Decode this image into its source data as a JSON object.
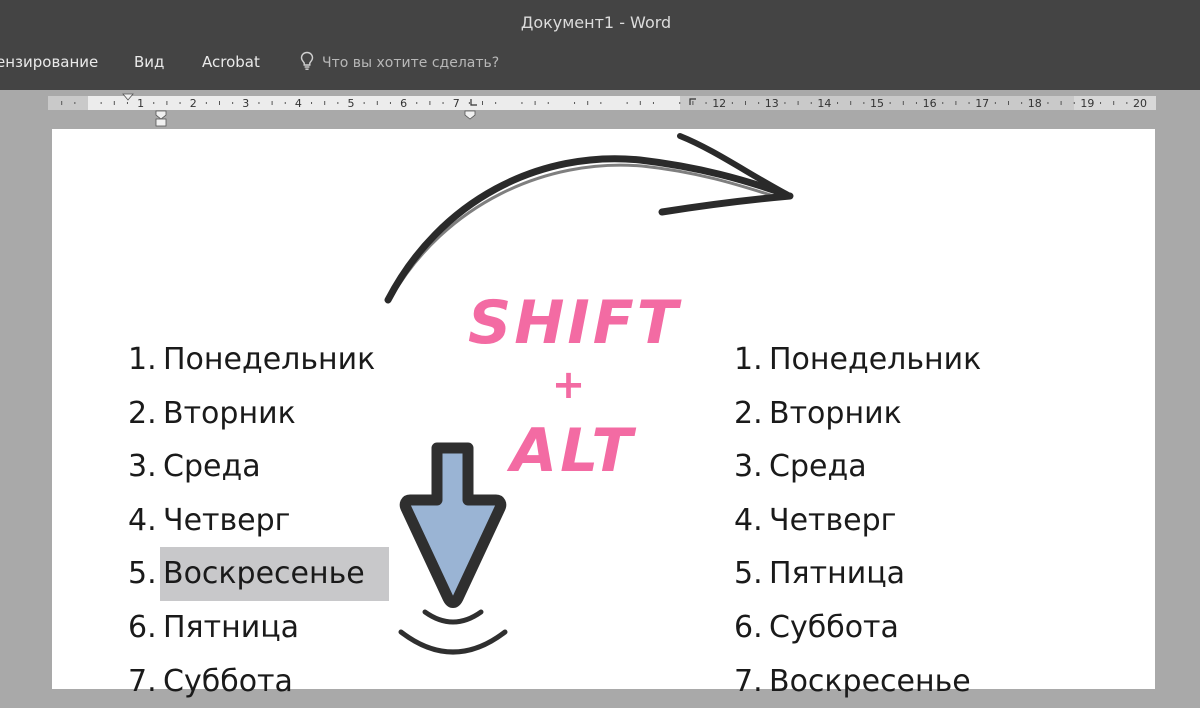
{
  "window": {
    "title": "Документ1 - Word"
  },
  "ribbon": {
    "tabs": [
      "ензирование",
      "Вид",
      "Acrobat"
    ],
    "tell_me_placeholder": "Что вы хотите сделать?"
  },
  "ruler": {
    "left_labels": [
      "1",
      "2",
      "3",
      "4",
      "5",
      "6",
      "7"
    ],
    "right_labels": [
      "12",
      "13",
      "14",
      "15",
      "16",
      "17",
      "18",
      "19",
      "20"
    ]
  },
  "document": {
    "before_list": [
      {
        "num": "1.",
        "text": "Понедельник"
      },
      {
        "num": "2.",
        "text": "Вторник"
      },
      {
        "num": "3.",
        "text": "Среда"
      },
      {
        "num": "4.",
        "text": "Четверг"
      },
      {
        "num": "5.",
        "text": "Воскресенье"
      },
      {
        "num": "6.",
        "text": "Пятница"
      },
      {
        "num": "7.",
        "text": "Суббота"
      }
    ],
    "after_list": [
      {
        "num": "1.",
        "text": "Понедельник"
      },
      {
        "num": "2.",
        "text": "Вторник"
      },
      {
        "num": "3.",
        "text": "Среда"
      },
      {
        "num": "4.",
        "text": "Четверг"
      },
      {
        "num": "5.",
        "text": "Пятница"
      },
      {
        "num": "6.",
        "text": "Суббота"
      },
      {
        "num": "7.",
        "text": "Воскресенье"
      }
    ],
    "selected_item_index": 4
  },
  "overlay": {
    "shortcut_line1": "SHIFT",
    "shortcut_plus": "+",
    "shortcut_line2": "ALT",
    "shortcut_color": "#f36ba3",
    "arrow_icon": "down-arrow-key-press-icon",
    "arrow_fill": "#9ab4d4",
    "curved_arrow_icon": "curved-arrow-icon"
  }
}
